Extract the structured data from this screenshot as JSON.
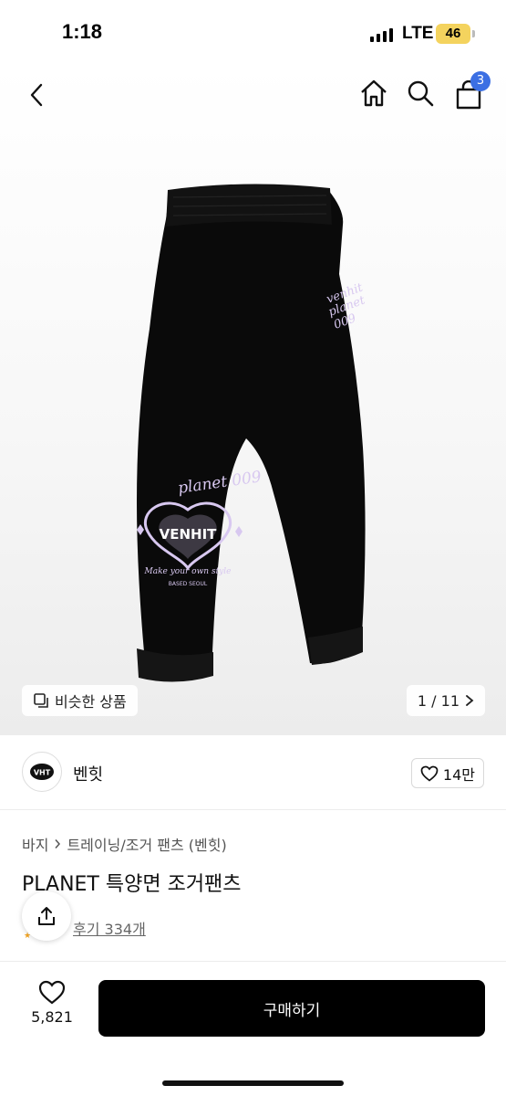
{
  "status_bar": {
    "time": "1:18",
    "network": "LTE",
    "battery": "46"
  },
  "nav": {
    "back_icon": "chevron-left-icon",
    "home_icon": "home-icon",
    "search_icon": "search-icon",
    "cart_icon": "shopping-bag-icon",
    "cart_count": "3"
  },
  "gallery": {
    "similar_label": "비슷한 상품",
    "page_indicator": "1 / 11",
    "artwork": {
      "hip_print": [
        "venhit",
        "planet",
        "009"
      ],
      "knee_print_top": "planet 009",
      "knee_print_heart": "VENHIT",
      "knee_print_tagline": "Make your own style",
      "knee_print_city": "BASED SEOUL"
    }
  },
  "brand": {
    "name": "벤힛",
    "logo_text": "VHT",
    "likes": "14만"
  },
  "product": {
    "breadcrumb_category": "바지",
    "breadcrumb_sub": "트레이닝/조거 팬츠 (벤힛)",
    "title": "PLANET 특양면 조거팬츠",
    "review_link": "후기 334개"
  },
  "bottom": {
    "wish_count": "5,821",
    "buy_label": "구매하기"
  },
  "colors": {
    "badge": "#3b6fe3",
    "buy_button": "#000000",
    "product": "#0a0a0a",
    "print": "#d8c8f0"
  }
}
